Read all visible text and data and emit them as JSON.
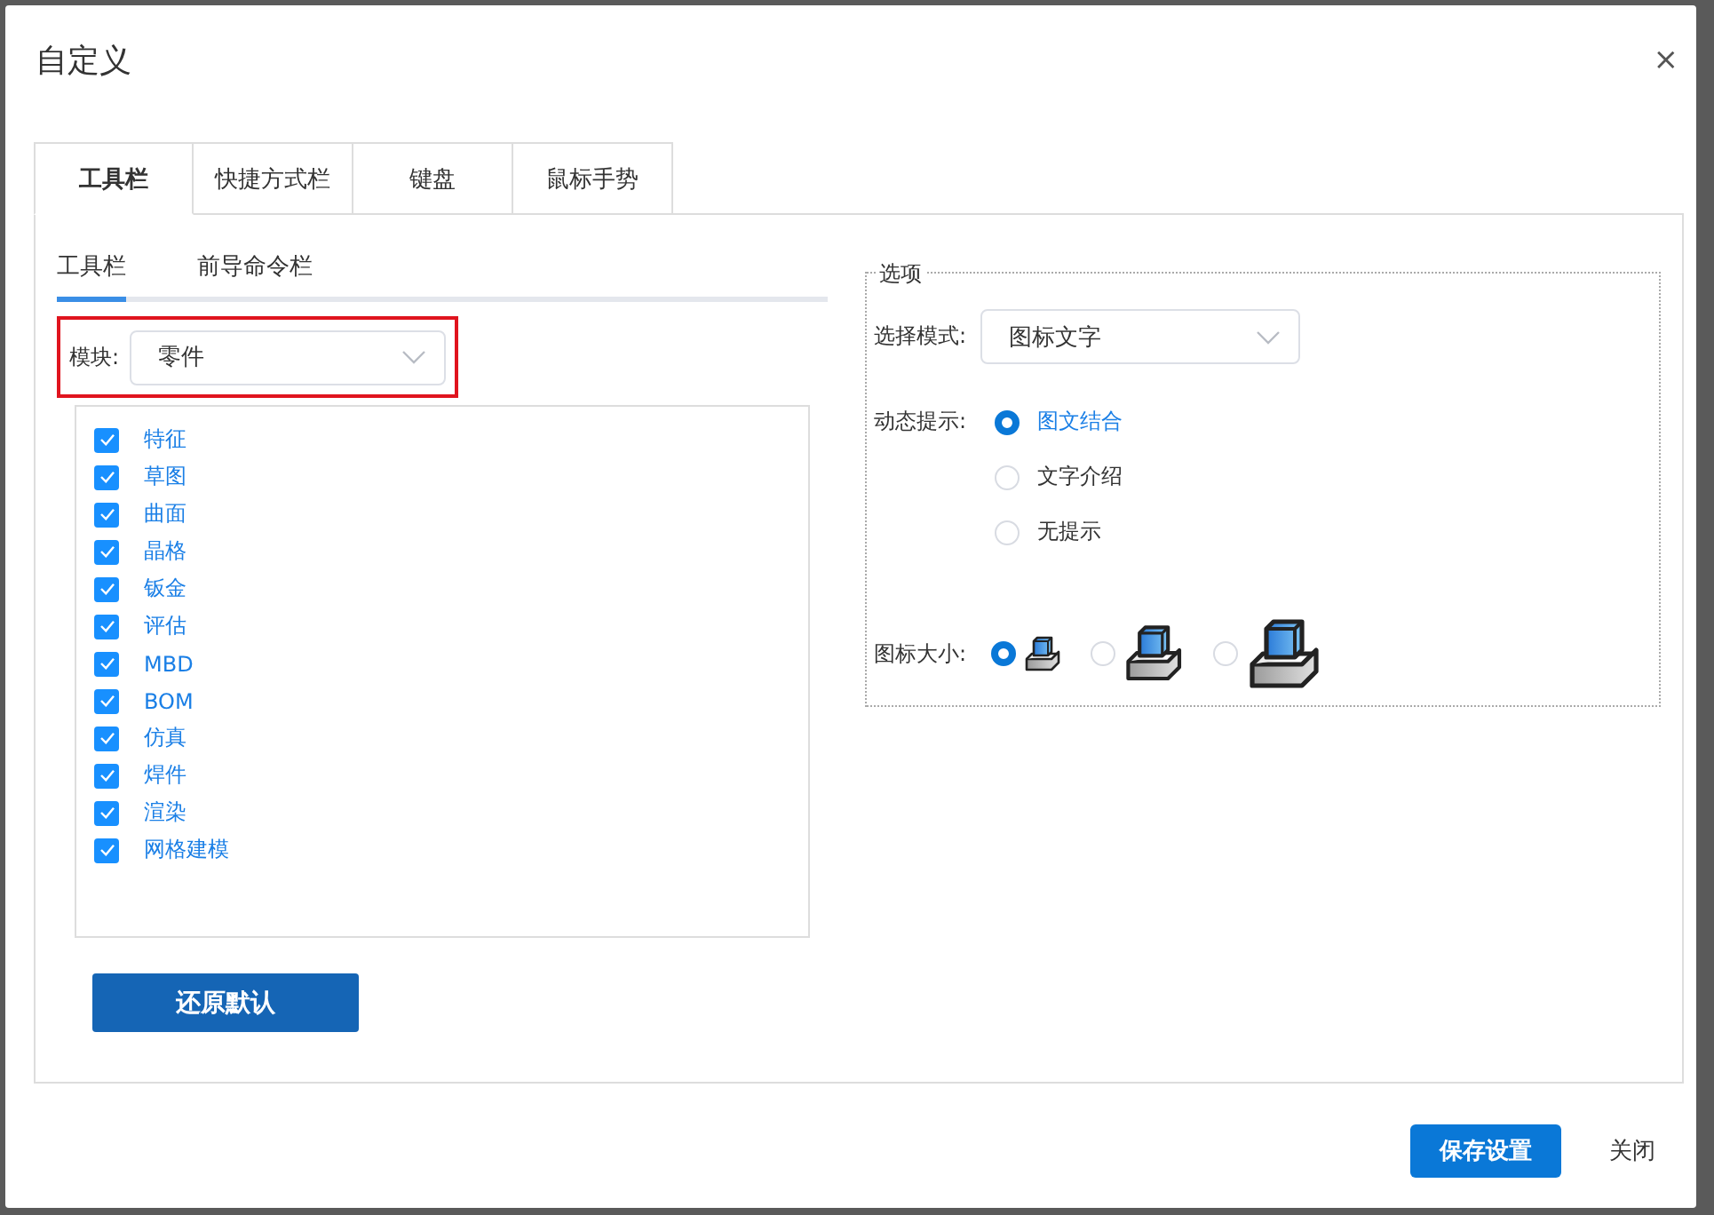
{
  "window": {
    "title": "自定义",
    "close": "×"
  },
  "tabs": [
    {
      "label": "工具栏",
      "selected": true
    },
    {
      "label": "快捷方式栏",
      "selected": false
    },
    {
      "label": "键盘",
      "selected": false
    },
    {
      "label": "鼠标手势",
      "selected": false
    }
  ],
  "subtabs": [
    {
      "label": "工具栏",
      "selected": true
    },
    {
      "label": "前导命令栏",
      "selected": false
    }
  ],
  "module": {
    "label": "模块:",
    "value": "零件",
    "highlighted": true
  },
  "modules": [
    {
      "label": "特征",
      "checked": true
    },
    {
      "label": "草图",
      "checked": true
    },
    {
      "label": "曲面",
      "checked": true
    },
    {
      "label": "晶格",
      "checked": true
    },
    {
      "label": "钣金",
      "checked": true
    },
    {
      "label": "评估",
      "checked": true
    },
    {
      "label": "MBD",
      "checked": true
    },
    {
      "label": "BOM",
      "checked": true
    },
    {
      "label": "仿真",
      "checked": true
    },
    {
      "label": "焊件",
      "checked": true
    },
    {
      "label": "渲染",
      "checked": true
    },
    {
      "label": "网格建模",
      "checked": true
    }
  ],
  "restore_button": "还原默认",
  "options": {
    "legend": "选项",
    "mode": {
      "label": "选择模式:",
      "value": "图标文字"
    },
    "hint": {
      "label": "动态提示:",
      "choices": [
        {
          "label": "图文结合",
          "selected": true
        },
        {
          "label": "文字介绍",
          "selected": false
        },
        {
          "label": "无提示",
          "selected": false
        }
      ]
    },
    "icon_size": {
      "label": "图标大小:",
      "choices": [
        {
          "selected": true
        },
        {
          "selected": false
        },
        {
          "selected": false
        }
      ]
    }
  },
  "buttons": [
    {
      "label": "保存设置",
      "kind": "primary"
    },
    {
      "label": "关闭",
      "kind": "plain"
    }
  ]
}
